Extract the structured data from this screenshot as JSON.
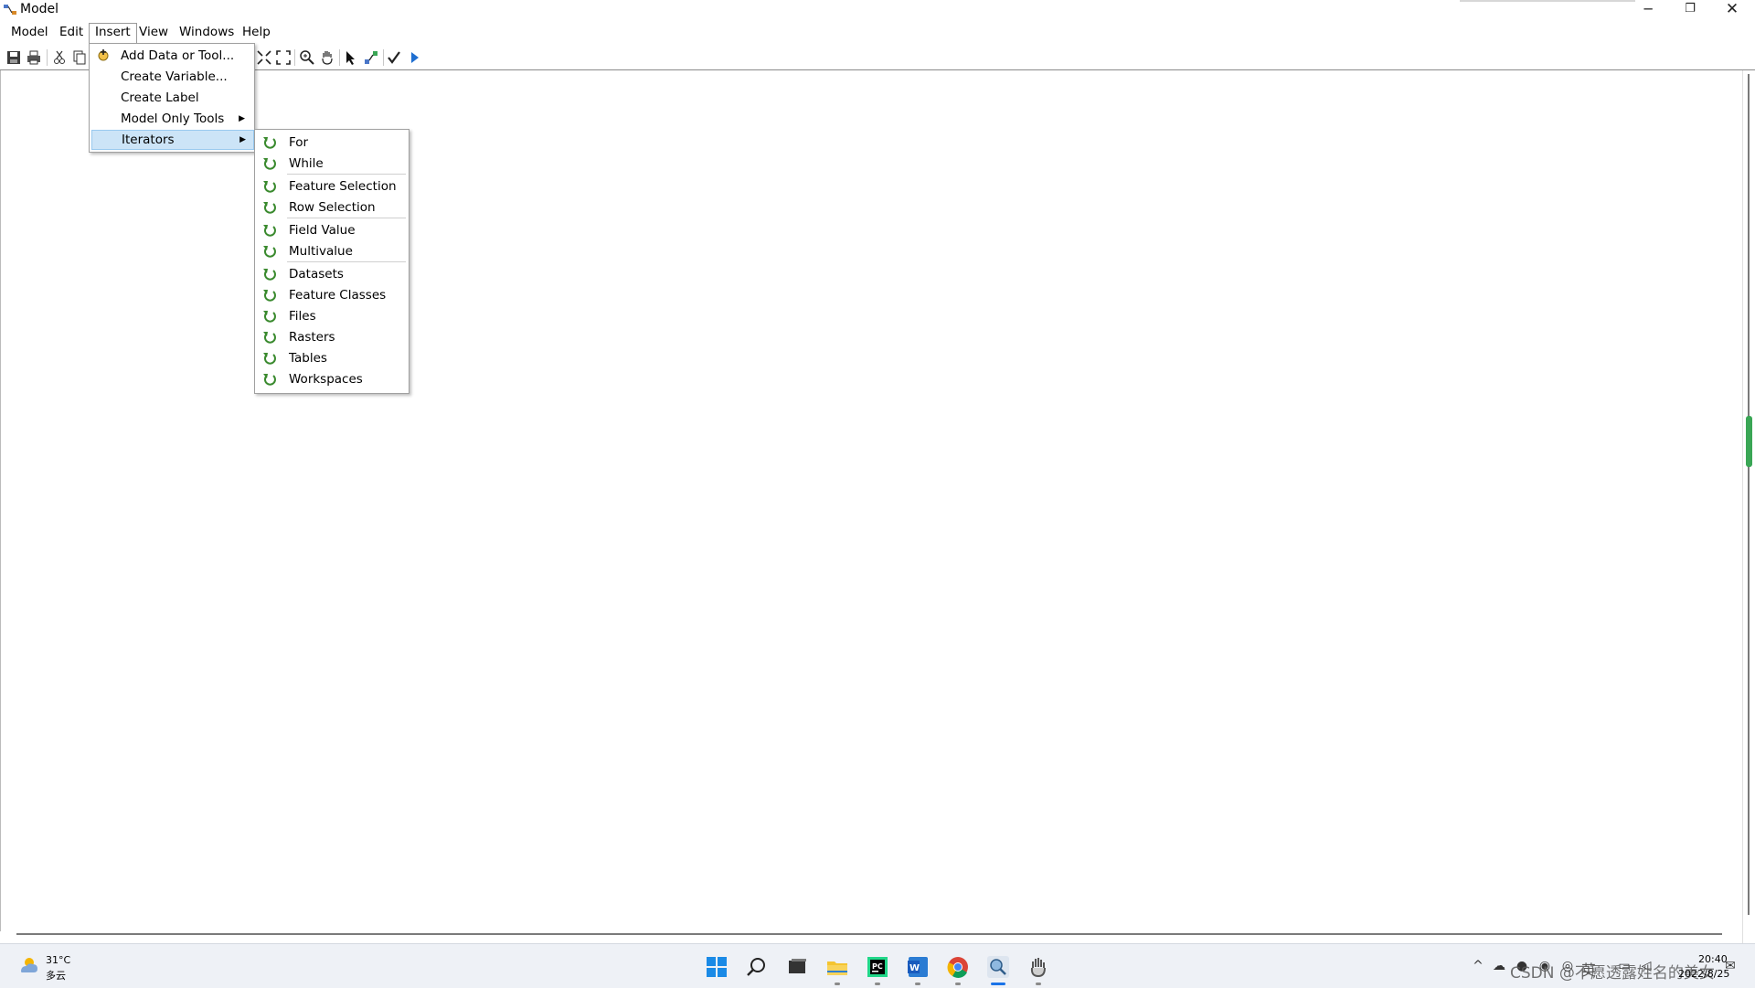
{
  "window": {
    "title": "Model",
    "minimize_glyph": "─",
    "maximize_glyph": "❐",
    "close_glyph": "✕"
  },
  "menubar": {
    "items": [
      "Model",
      "Edit",
      "Insert",
      "View",
      "Windows",
      "Help"
    ],
    "active": "Insert"
  },
  "toolbar": {
    "buttons": [
      "save-icon",
      "print-icon",
      "cut-icon",
      "copy-icon",
      "full-extent-icon",
      "fit-screen-icon",
      "zoom-in-icon",
      "pan-hand-icon",
      "select-arrow-icon",
      "connect-icon",
      "validate-check-icon",
      "run-play-icon"
    ]
  },
  "insert_menu": {
    "items": [
      {
        "label": "Add Data or Tool...",
        "icon": "add-data-icon",
        "submenu": false
      },
      {
        "label": "Create Variable...",
        "submenu": false
      },
      {
        "label": "Create Label",
        "submenu": false
      },
      {
        "label": "Model Only Tools",
        "submenu": true
      },
      {
        "label": "Iterators",
        "submenu": true,
        "highlighted": true
      }
    ]
  },
  "iterators_submenu": {
    "items": [
      "For",
      "While",
      "Feature Selection",
      "Row Selection",
      "Field Value",
      "Multivalue",
      "Datasets",
      "Feature Classes",
      "Files",
      "Rasters",
      "Tables",
      "Workspaces"
    ],
    "icon": "iterator-loop-icon",
    "icon_color": "#3a8a2e"
  },
  "taskbar": {
    "weather": {
      "temp": "31°C",
      "condition": "多云"
    },
    "apps": [
      "windows-start-icon",
      "search-icon",
      "task-view-icon",
      "file-explorer-icon",
      "pycharm-icon",
      "word-icon",
      "chrome-icon",
      "arcgis-icon",
      "hand-tool-icon"
    ],
    "tray_lang": "英",
    "watermark": "CSDN @不愿透露姓名的美女",
    "clock_time": "20:40",
    "clock_date": "2022/8/25"
  },
  "colors": {
    "menu_highlight": "#cce4f7",
    "taskbar_bg": "#eef1f6",
    "scroll_thumb": "#3aa655"
  }
}
